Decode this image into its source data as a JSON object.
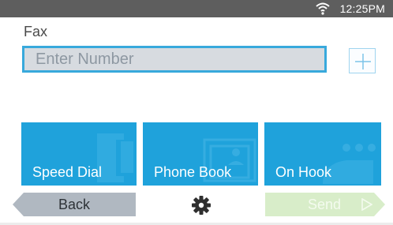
{
  "status_bar": {
    "wifi_icon": "wifi-icon",
    "time": "12:25PM"
  },
  "screen": {
    "title": "Fax"
  },
  "number_input": {
    "placeholder": "Enter Number",
    "value": ""
  },
  "add_button": {
    "icon": "plus-icon"
  },
  "tiles": [
    {
      "label": "Speed Dial",
      "icon": "phone-icon"
    },
    {
      "label": "Phone Book",
      "icon": "address-book-icon"
    },
    {
      "label": "On Hook",
      "icon": "handset-icon"
    }
  ],
  "footer": {
    "back_label": "Back",
    "settings_icon": "gear-icon",
    "send_label": "Send",
    "send_icon": "play-arrow-icon"
  },
  "colors": {
    "accent": "#1fa2db",
    "status_bar": "#5e5e5e",
    "send_disabled": "#d8edc9",
    "back": "#b0b8c1"
  }
}
